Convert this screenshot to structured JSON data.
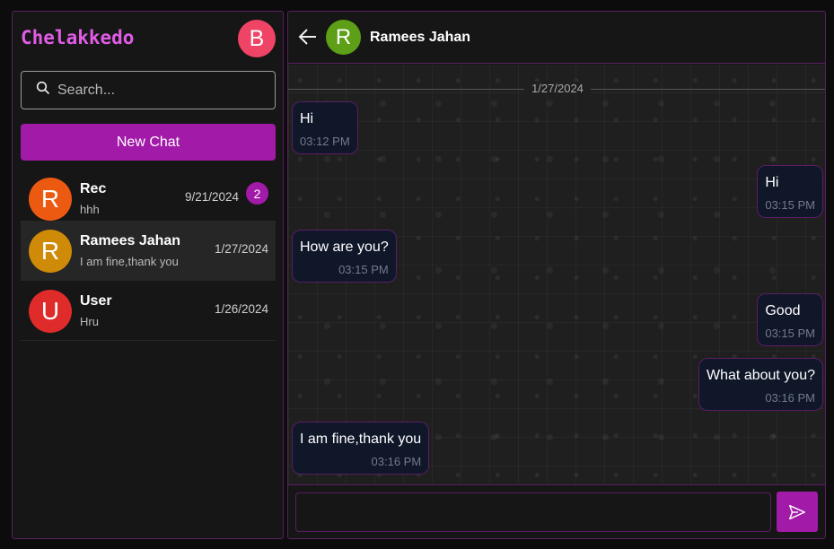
{
  "app": {
    "title": "Chelakkedo"
  },
  "me": {
    "initial": "B",
    "color": "#ef4465"
  },
  "search": {
    "placeholder": "Search..."
  },
  "new_chat": {
    "label": "New Chat"
  },
  "chats": [
    {
      "initial": "R",
      "color": "#ec5a12",
      "name": "Rec",
      "preview": "hhh",
      "date": "9/21/2024",
      "unread": "2"
    },
    {
      "initial": "R",
      "color": "#cf8a07",
      "name": "Ramees Jahan",
      "preview": "I am fine,thank you",
      "date": "1/27/2024",
      "active": true
    },
    {
      "initial": "U",
      "color": "#e02b2b",
      "name": "User",
      "preview": "Hru",
      "date": "1/26/2024"
    }
  ],
  "conversation": {
    "contact_initial": "R",
    "contact_color": "#5d9f16",
    "contact_name": "Ramees Jahan",
    "date_divider": "1/27/2024",
    "messages": [
      {
        "side": "left",
        "text": "Hi",
        "time": "03:12 PM"
      },
      {
        "side": "right",
        "text": "Hi",
        "time": "03:15 PM"
      },
      {
        "side": "left",
        "text": "How are you?",
        "time": "03:15 PM"
      },
      {
        "side": "right",
        "text": "Good",
        "time": "03:15 PM"
      },
      {
        "side": "right",
        "text": "What about you?",
        "time": "03:16 PM"
      },
      {
        "side": "left",
        "text": "I am fine,thank you",
        "time": "03:16 PM"
      }
    ]
  },
  "composer": {
    "placeholder": ""
  },
  "icons": {
    "search": "search-icon",
    "back": "arrow-left-icon",
    "send": "send-icon"
  },
  "colors": {
    "accent": "#a11aa8",
    "border": "#5a1e63",
    "bubble": "#0f1729",
    "brand": "#e05ce6"
  }
}
